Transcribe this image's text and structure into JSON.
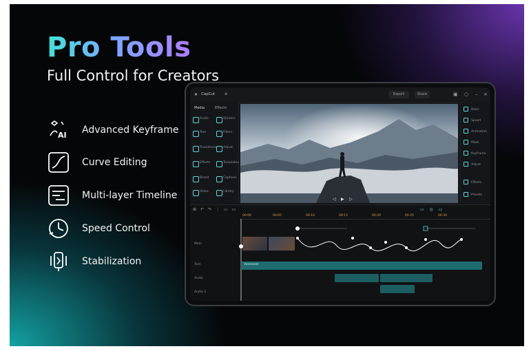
{
  "hero": {
    "title": "Pro Tools",
    "subtitle": "Full Control for Creators"
  },
  "features": [
    {
      "label": "Advanced Keyframe",
      "icon": "keyframe-ai-icon"
    },
    {
      "label": "Curve Editing",
      "icon": "curve-icon"
    },
    {
      "label": "Multi-layer Timeline",
      "icon": "timeline-layers-icon"
    },
    {
      "label": "Speed Control",
      "icon": "speedometer-icon"
    },
    {
      "label": "Stabilization",
      "icon": "stabilization-icon"
    }
  ],
  "colors": {
    "accent_teal": "#3fd0cc",
    "accent_purple": "#8a5cff",
    "clip_teal": "#1f6f72",
    "curve_white": "#ffffff"
  },
  "app": {
    "name": "CapCut",
    "topbar_buttons": [
      "Export",
      "Share"
    ],
    "left_panel": {
      "tabs": [
        "Media",
        "Effects"
      ],
      "items": [
        "Audio",
        "Stickers",
        "Text",
        "Filters",
        "Transitions",
        "Adjust",
        "Effects",
        "Templates",
        "Brand",
        "Captions",
        "Video",
        "Library"
      ]
    },
    "right_panel": {
      "items": [
        "Basic",
        "Speed",
        "Animation",
        "Mask",
        "Keyframe",
        "Adjust",
        "Effects",
        "Presets"
      ]
    },
    "timeline": {
      "ruler_marks": [
        "00:00",
        "00:05",
        "00:10",
        "00:15",
        "00:20",
        "00:25",
        "00:30"
      ],
      "tracks": [
        "Main",
        "Text",
        "Audio",
        "Audio 2"
      ],
      "clip_label": "Voiceover"
    }
  }
}
